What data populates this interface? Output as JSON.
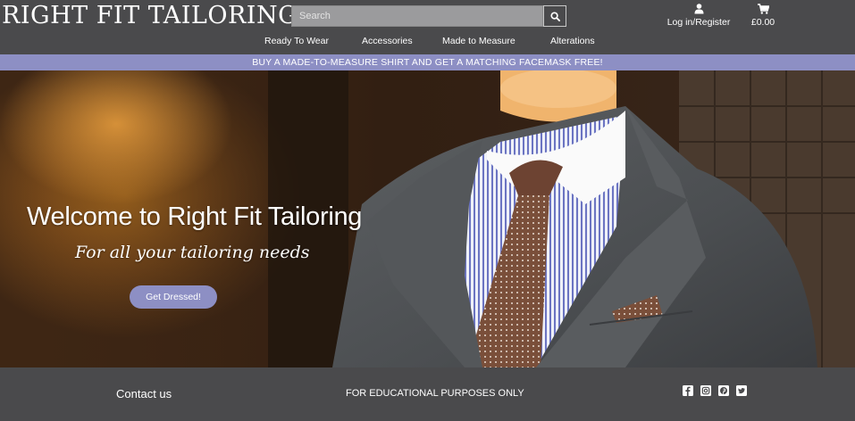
{
  "header": {
    "brand": "Right Fit Tailoring",
    "search_placeholder": "Search",
    "account_label": "Log in/Register",
    "bag_total": "£0.00",
    "icons": {
      "search": "search-icon",
      "account": "user-icon",
      "bag": "shopping-cart-icon"
    }
  },
  "nav": {
    "items": [
      {
        "label": "Ready To Wear"
      },
      {
        "label": "Accessories"
      },
      {
        "label": "Made to Measure"
      },
      {
        "label": "Alterations"
      }
    ]
  },
  "promo": {
    "text": "BUY A MADE-TO-MEASURE SHIRT AND GET A MATCHING FACEMASK FREE!"
  },
  "hero": {
    "title": "Welcome to Right Fit Tailoring",
    "subtitle": "For all your tailoring needs",
    "button_label": "Get Dressed!"
  },
  "footer": {
    "contact_label": "Contact us",
    "notice": "FOR EDUCATIONAL PURPOSES ONLY",
    "social": [
      "facebook-icon",
      "instagram-icon",
      "pinterest-icon",
      "twitter-icon"
    ]
  },
  "colors": {
    "bar_bg": "#4a4a4c",
    "accent": "#8d8fc4"
  }
}
